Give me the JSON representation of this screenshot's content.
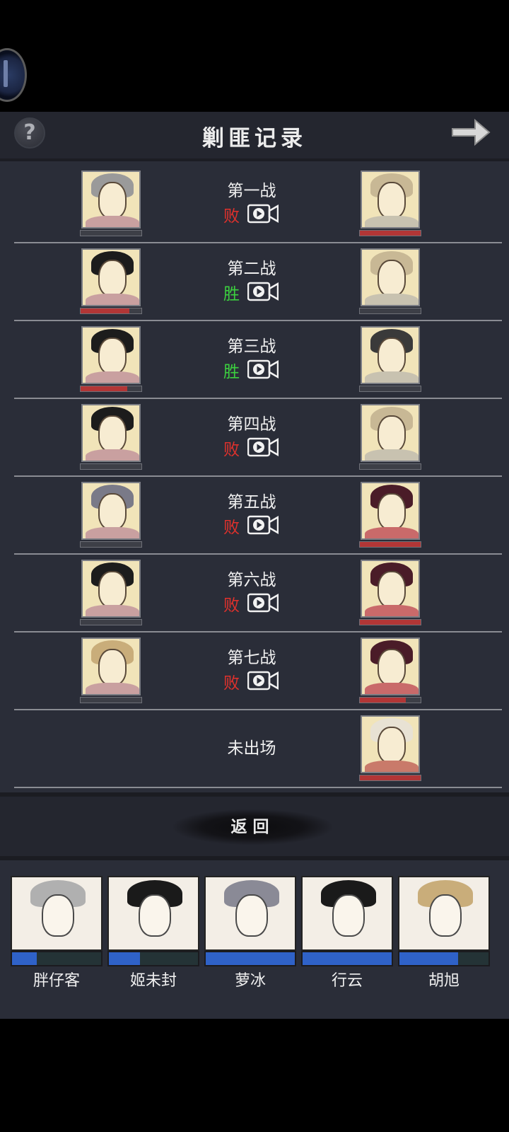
{
  "panel": {
    "title": "剿匪记录",
    "help_symbol": "?",
    "return_label": "返回"
  },
  "colors": {
    "lose": "#e2312c",
    "win": "#3ccf3f",
    "hp": "#b23636",
    "team_bar": "#2f62c8"
  },
  "battles": [
    {
      "name": "第一战",
      "result": "败",
      "outcome": "lose",
      "left_hp": 0.0,
      "right_hp": 1.0
    },
    {
      "name": "第二战",
      "result": "胜",
      "outcome": "win",
      "left_hp": 0.8,
      "right_hp": 0.0
    },
    {
      "name": "第三战",
      "result": "胜",
      "outcome": "win",
      "left_hp": 0.77,
      "right_hp": 0.0
    },
    {
      "name": "第四战",
      "result": "败",
      "outcome": "lose",
      "left_hp": 0.0,
      "right_hp": 0.0
    },
    {
      "name": "第五战",
      "result": "败",
      "outcome": "lose",
      "left_hp": 0.0,
      "right_hp": 1.0
    },
    {
      "name": "第六战",
      "result": "败",
      "outcome": "lose",
      "left_hp": 0.0,
      "right_hp": 1.0
    },
    {
      "name": "第七战",
      "result": "败",
      "outcome": "lose",
      "left_hp": 0.0,
      "right_hp": 0.75
    }
  ],
  "unplayed": {
    "label": "未出场",
    "right_hp": 1.0
  },
  "team": [
    {
      "name": "胖仔客",
      "bar": 0.28
    },
    {
      "name": "姬未封",
      "bar": 0.35
    },
    {
      "name": "萝冰",
      "bar": 1.0
    },
    {
      "name": "行云",
      "bar": 1.0
    },
    {
      "name": "胡旭",
      "bar": 0.66
    }
  ]
}
